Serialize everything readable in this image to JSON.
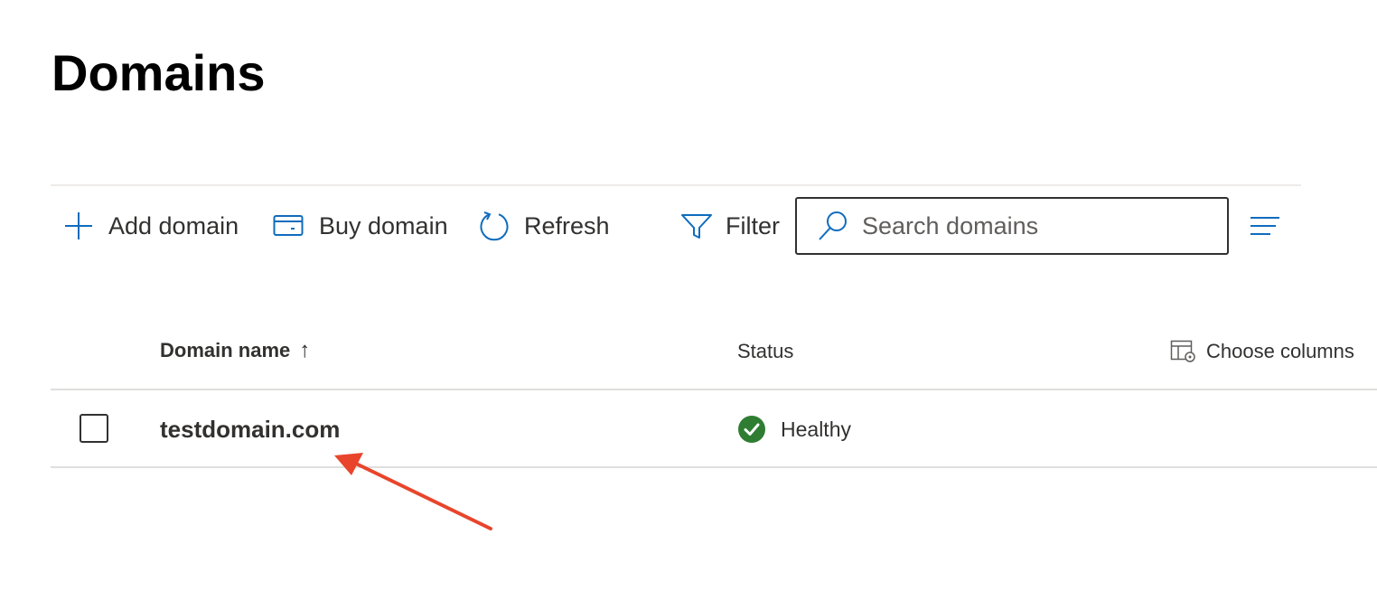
{
  "page": {
    "title": "Domains"
  },
  "toolbar": {
    "add_domain_label": "Add domain",
    "buy_domain_label": "Buy domain",
    "refresh_label": "Refresh",
    "filter_label": "Filter",
    "search_placeholder": "Search domains",
    "search_value": ""
  },
  "table": {
    "columns": {
      "domain_name": "Domain name",
      "status": "Status",
      "choose_columns": "Choose columns"
    },
    "sort_indicator": "↑",
    "rows": [
      {
        "domain": "testdomain.com",
        "status": "Healthy",
        "checked": false
      }
    ]
  },
  "icons": {
    "add": "plus-icon",
    "buy": "card-icon",
    "refresh": "refresh-icon",
    "filter": "filter-icon",
    "search": "search-icon",
    "view_options": "lines-icon",
    "choose_columns": "column-settings-icon",
    "status_ok": "check-circle-icon",
    "annotation": "red-arrow"
  },
  "colors": {
    "accent": "#0f6cbd",
    "success": "#2f7d32",
    "annotation": "#e8452c",
    "text": "#323130"
  }
}
